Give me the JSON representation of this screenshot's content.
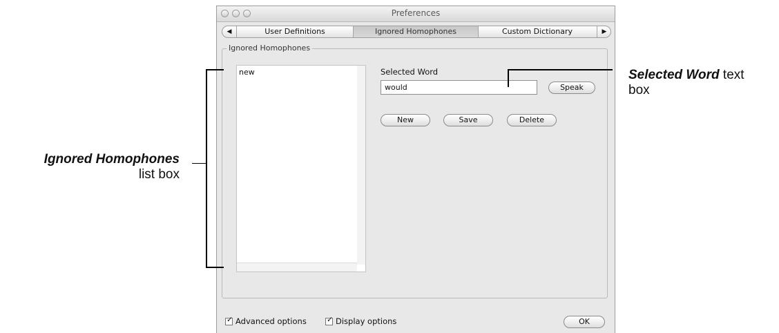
{
  "window": {
    "title": "Preferences"
  },
  "tabs": [
    {
      "label": "User Definitions"
    },
    {
      "label": "Ignored Homophones"
    },
    {
      "label": "Custom Dictionary"
    }
  ],
  "tab_arrows": {
    "left": "◀",
    "right": "▶"
  },
  "panel": {
    "legend": "Ignored Homophones",
    "list_items": [
      "new"
    ],
    "selected_word_label": "Selected Word",
    "selected_word_value": "would",
    "speak_button": "Speak",
    "new_button": "New",
    "save_button": "Save",
    "delete_button": "Delete"
  },
  "footer": {
    "advanced_options": "Advanced options",
    "display_options": "Display options",
    "ok_button": "OK"
  },
  "annotations": {
    "list_box_bold": "Ignored Homophones",
    "list_box_rest": "list box",
    "text_box_bold": "Selected Word",
    "text_box_rest": " text",
    "text_box_rest2": "box"
  }
}
